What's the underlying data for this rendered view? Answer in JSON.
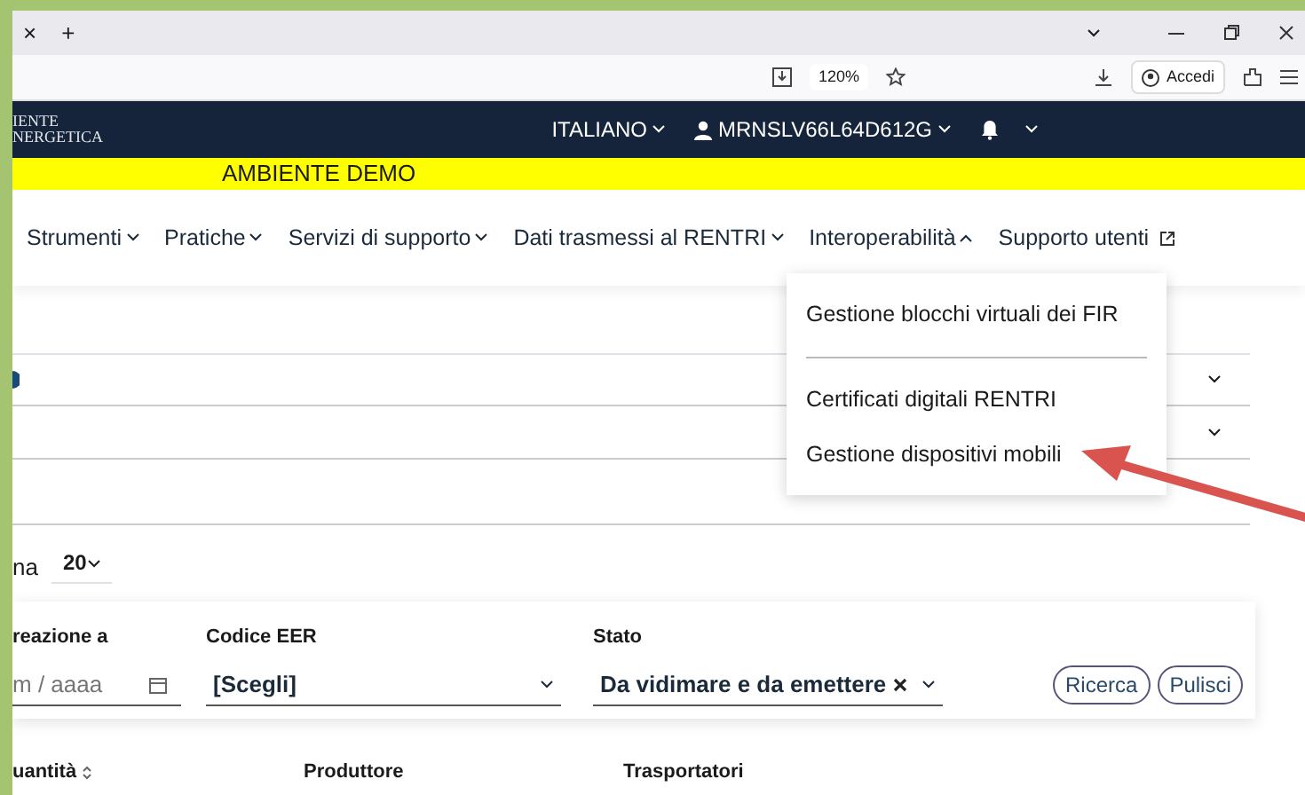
{
  "browser": {
    "tab_close": "×",
    "new_tab": "+",
    "zoom": "120%",
    "signin": "Accedi"
  },
  "header": {
    "logo_lines": [
      "IENTE",
      "NERGETICA"
    ],
    "language": "ITALIANO",
    "user": "MRNSLV66L64D612G"
  },
  "banner": "AMBIENTE DEMO",
  "nav": [
    {
      "label": "Strumenti",
      "kind": "dropdown",
      "expanded": false
    },
    {
      "label": "Pratiche",
      "kind": "dropdown",
      "expanded": false
    },
    {
      "label": "Servizi di supporto",
      "kind": "dropdown",
      "expanded": false
    },
    {
      "label": "Dati trasmessi al RENTRI",
      "kind": "dropdown",
      "expanded": false
    },
    {
      "label": "Interoperabilità",
      "kind": "dropdown",
      "expanded": true
    },
    {
      "label": "Supporto utenti",
      "kind": "external"
    }
  ],
  "menu": [
    [
      "Gestione blocchi virtuali dei FIR"
    ],
    [
      "Certificati digitali RENTRI",
      "Gestione dispositivi mobili"
    ]
  ],
  "page_size": {
    "label": "na",
    "value": "20"
  },
  "filters": [
    {
      "kind": "date",
      "label": "reazione a",
      "placeholder": "m / aaaa"
    },
    {
      "kind": "select",
      "label": "Codice EER",
      "value": "[Scegli]",
      "clearable": false
    },
    {
      "kind": "select",
      "label": "Stato",
      "value": "Da vidimare e da emettere",
      "clearable": true
    }
  ],
  "buttons": [
    "Ricerca",
    "Pulisci"
  ],
  "table": {
    "columns": [
      {
        "label": "uantità",
        "sortable": true
      },
      {
        "label": "Produttore",
        "sortable": false
      },
      {
        "label": "Trasportatori",
        "sortable": false
      }
    ]
  }
}
